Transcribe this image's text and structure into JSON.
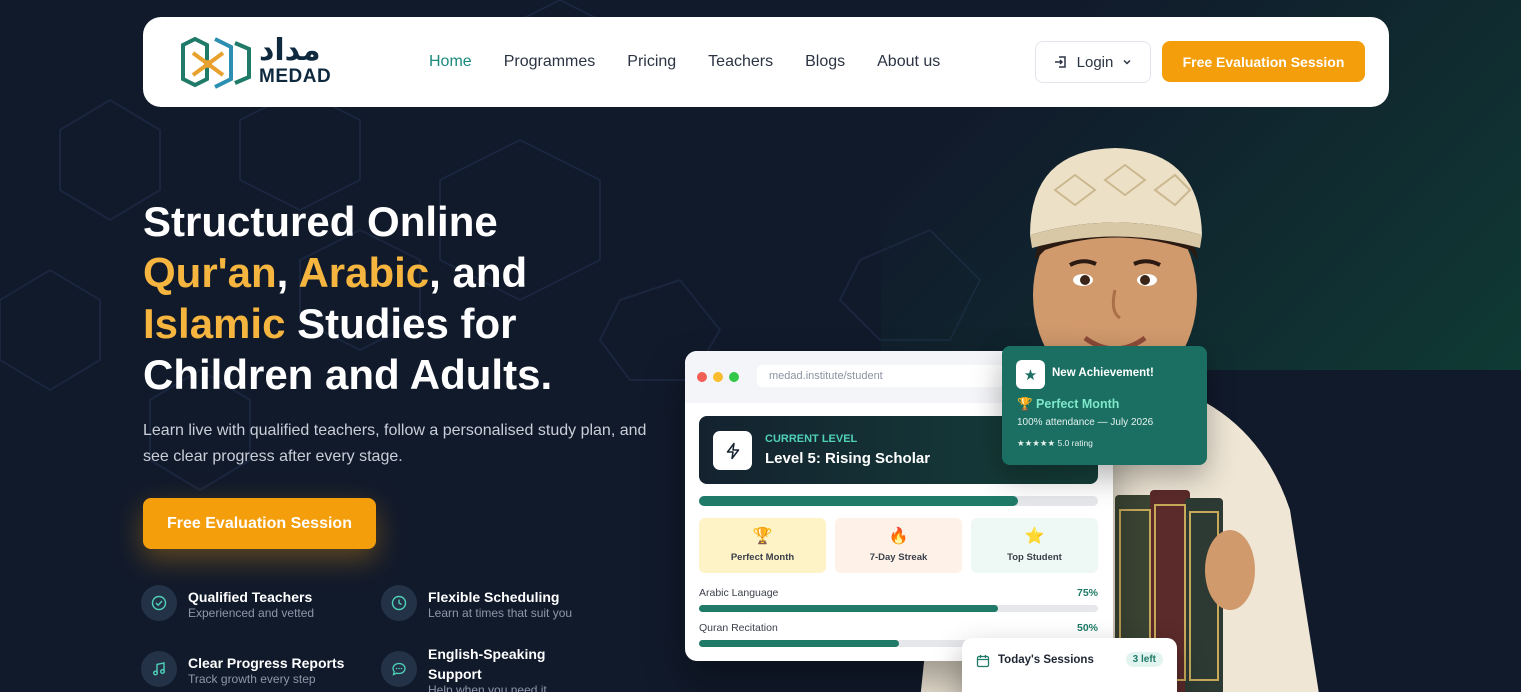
{
  "brand": {
    "name_arabic": "مداد",
    "name_latin": "MEDAD"
  },
  "nav": {
    "links": [
      {
        "label": "Home",
        "active": true
      },
      {
        "label": "Programmes"
      },
      {
        "label": "Pricing"
      },
      {
        "label": "Teachers"
      },
      {
        "label": "Blogs"
      },
      {
        "label": "About us"
      }
    ],
    "login_label": "Login",
    "cta_label": "Free Evaluation Session"
  },
  "hero": {
    "title_line1": "Structured Online",
    "title_hl1": "Qur'an",
    "title_sep1": ", ",
    "title_hl2": "Arabic",
    "title_sep2": ", and",
    "title_hl3": "Islamic",
    "title_rest3": " Studies for",
    "title_line4": "Children and Adults.",
    "subtitle": "Learn live with qualified teachers, follow a personalised study plan, and see clear progress after every stage.",
    "cta_label": "Free Evaluation Session"
  },
  "features": [
    {
      "title": "Qualified Teachers",
      "desc": "Experienced and vetted",
      "icon": "check-circle-icon"
    },
    {
      "title": "Flexible Scheduling",
      "desc": "Learn at times that suit you",
      "icon": "clock-icon"
    },
    {
      "title": "Clear Progress Reports",
      "desc": "Track growth every step",
      "icon": "music-note-icon"
    },
    {
      "title": "English-Speaking Support",
      "desc": "Help when you need it",
      "icon": "chat-bubble-icon"
    }
  ],
  "dashboard": {
    "url": "medad.institute/student",
    "level_kicker": "CURRENT LEVEL",
    "level_name": "Level 5: Rising Scholar",
    "level_progress": 0.8,
    "badges": [
      {
        "icon": "🏆",
        "label": "Perfect Month",
        "bg": "#fdf3c6"
      },
      {
        "icon": "🔥",
        "label": "7-Day Streak",
        "bg": "#fdf1e8"
      },
      {
        "icon": "⭐",
        "label": "Top Student",
        "bg": "#eef8f4"
      }
    ],
    "progress": [
      {
        "label": "Arabic Language",
        "pct_label": "75%",
        "value": 0.75
      },
      {
        "label": "Quran Recitation",
        "pct_label": "50%",
        "value": 0.5
      }
    ]
  },
  "achievement": {
    "title": "New Achievement!",
    "name": "🏆 Perfect Month",
    "detail": "100% attendance — July 2026",
    "rating": "★★★★★ 5.0 rating"
  },
  "sessions": {
    "title": "Today's Sessions",
    "left": "3 left"
  },
  "colors": {
    "accent": "#f59e0b",
    "highlight": "#f6b53f",
    "teal": "#1a8a7d",
    "background": "#111a2b"
  }
}
